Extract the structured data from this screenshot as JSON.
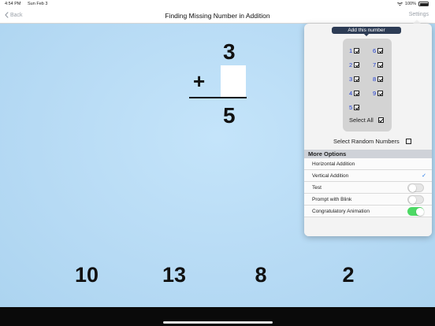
{
  "status_bar": {
    "time": "4:54 PM",
    "date": "Sun Feb 3",
    "battery": "100%"
  },
  "nav": {
    "back_label": "Back",
    "title": "Finding Missing Number in Addition",
    "settings_label": "Settings"
  },
  "problem": {
    "addend": "3",
    "operator": "+",
    "sum": "5",
    "answer": ""
  },
  "choices": [
    "10",
    "13",
    "8",
    "2"
  ],
  "settings": {
    "add_header": "Add this number",
    "numbers": [
      {
        "label": "1",
        "checked": true
      },
      {
        "label": "2",
        "checked": true
      },
      {
        "label": "3",
        "checked": true
      },
      {
        "label": "4",
        "checked": true
      },
      {
        "label": "5",
        "checked": true
      },
      {
        "label": "6",
        "checked": true
      },
      {
        "label": "7",
        "checked": true
      },
      {
        "label": "8",
        "checked": true
      },
      {
        "label": "9",
        "checked": true
      }
    ],
    "select_all_label": "Select All",
    "select_all_checked": true,
    "random_label": "Select Random Numbers",
    "random_checked": false,
    "more_options_label": "More Options",
    "options": [
      {
        "label": "Horizontal Addition",
        "control": "none"
      },
      {
        "label": "Vertical Addition",
        "control": "checkmark"
      },
      {
        "label": "Test",
        "control": "toggle",
        "on": false
      },
      {
        "label": "Prompt with Blink",
        "control": "toggle",
        "on": false
      },
      {
        "label": "Congratulatory Animation",
        "control": "toggle",
        "on": true
      }
    ]
  },
  "colors": {
    "background": "#b9dcf5",
    "number_label": "#1d3cd4",
    "header_bg": "#2d3c55",
    "toggle_on": "#4cd964",
    "checkmark": "#1a73e8"
  }
}
